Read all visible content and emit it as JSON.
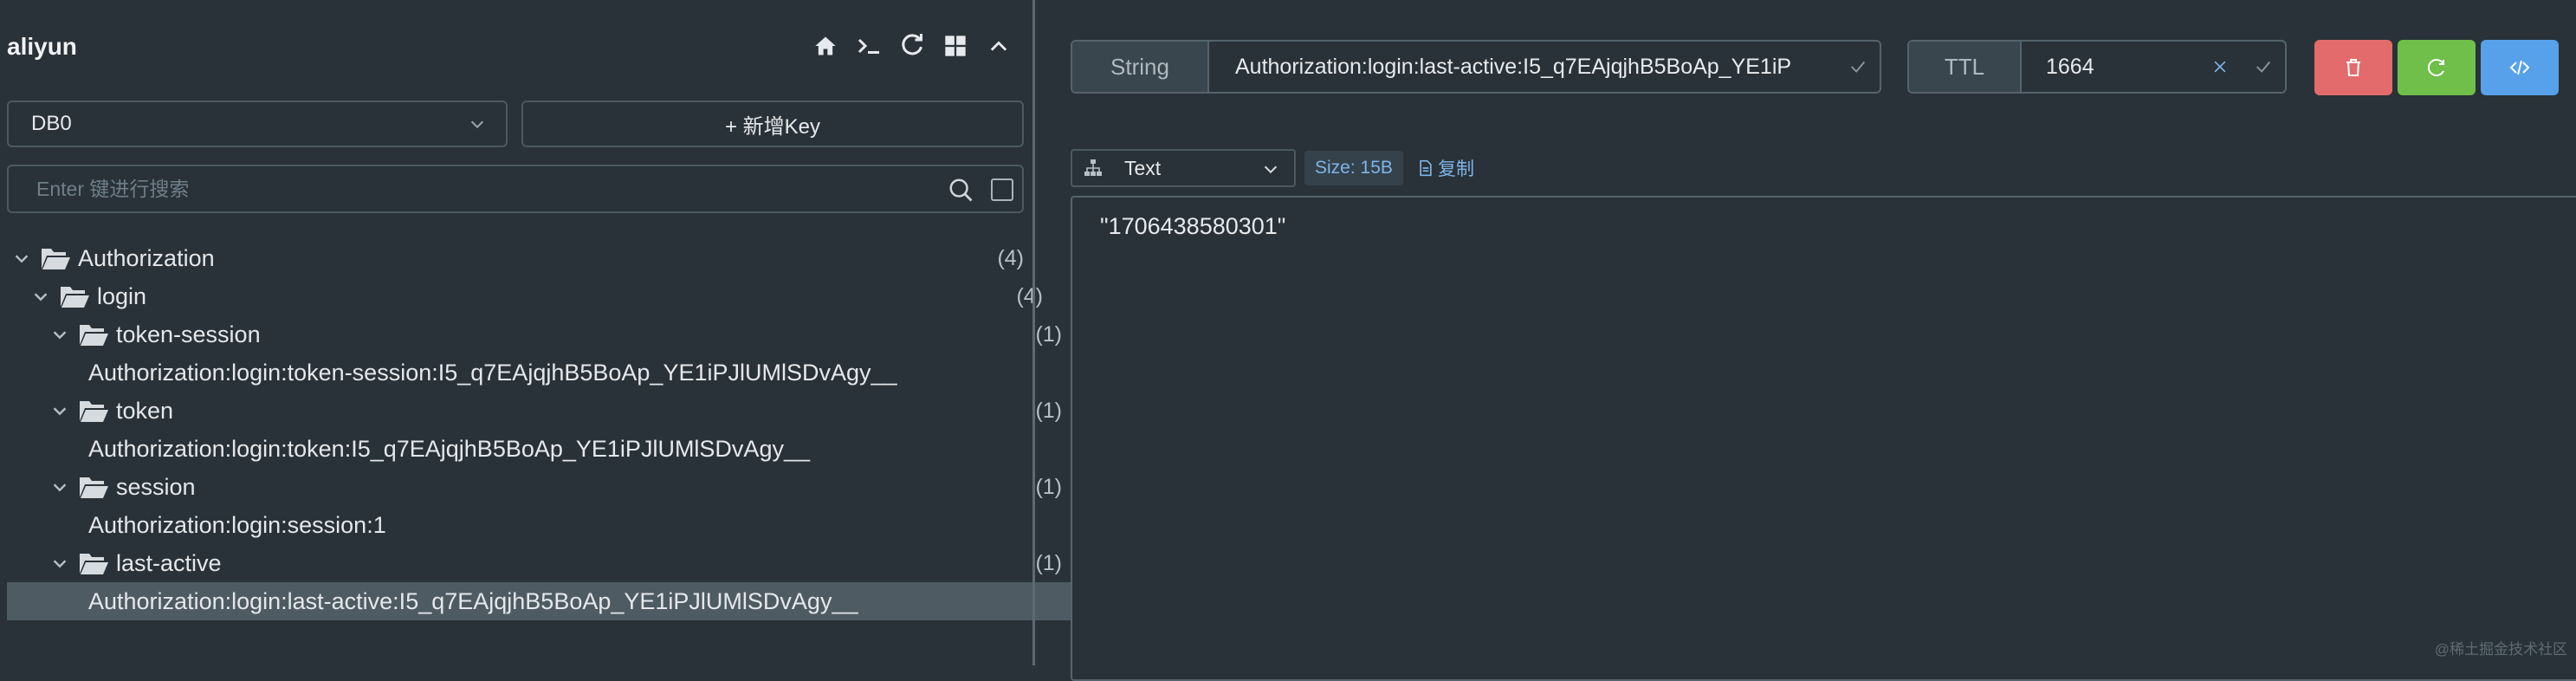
{
  "connection": {
    "name": "aliyun"
  },
  "toolbar_icons": [
    "home-icon",
    "terminal-icon",
    "refresh-icon",
    "grid-icon",
    "chevron-up-icon"
  ],
  "db_select": {
    "value": "DB0"
  },
  "add_key": {
    "label": "+ 新增Key"
  },
  "search": {
    "placeholder": "Enter 键进行搜索"
  },
  "tree": [
    {
      "label": "Authorization",
      "count": "(4)",
      "type": "folder"
    },
    {
      "label": "login",
      "count": "(4)",
      "type": "folder"
    },
    {
      "label": "token-session",
      "count": "(1)",
      "type": "folder"
    },
    {
      "label": "Authorization:login:token-session:I5_q7EAjqjhB5BoAp_YE1iPJlUMlSDvAgy__",
      "count": "",
      "type": "key"
    },
    {
      "label": "token",
      "count": "(1)",
      "type": "folder"
    },
    {
      "label": "Authorization:login:token:I5_q7EAjqjhB5BoAp_YE1iPJlUMlSDvAgy__",
      "count": "",
      "type": "key"
    },
    {
      "label": "session",
      "count": "(1)",
      "type": "folder"
    },
    {
      "label": "Authorization:login:session:1",
      "count": "",
      "type": "key"
    },
    {
      "label": "last-active",
      "count": "(1)",
      "type": "folder"
    },
    {
      "label": "Authorization:login:last-active:I5_q7EAjqjhB5BoAp_YE1iPJlUMlSDvAgy__",
      "count": "",
      "type": "key",
      "selected": true
    }
  ],
  "key_header": {
    "type": "String",
    "key_name": "Authorization:login:last-active:I5_q7EAjqjhB5BoAp_YE1iP",
    "ttl_label": "TTL",
    "ttl_value": "1664"
  },
  "viewer": {
    "format": "Text",
    "size": "Size: 15B",
    "copy_label": "复制",
    "content": "\"1706438580301\""
  },
  "watermark": "@稀土掘金技术社区",
  "colors": {
    "background": "#293238",
    "delete": "#e46b6b",
    "reload": "#6fbf4a",
    "code": "#56a1ea",
    "accent_text": "#7fb5e8"
  }
}
